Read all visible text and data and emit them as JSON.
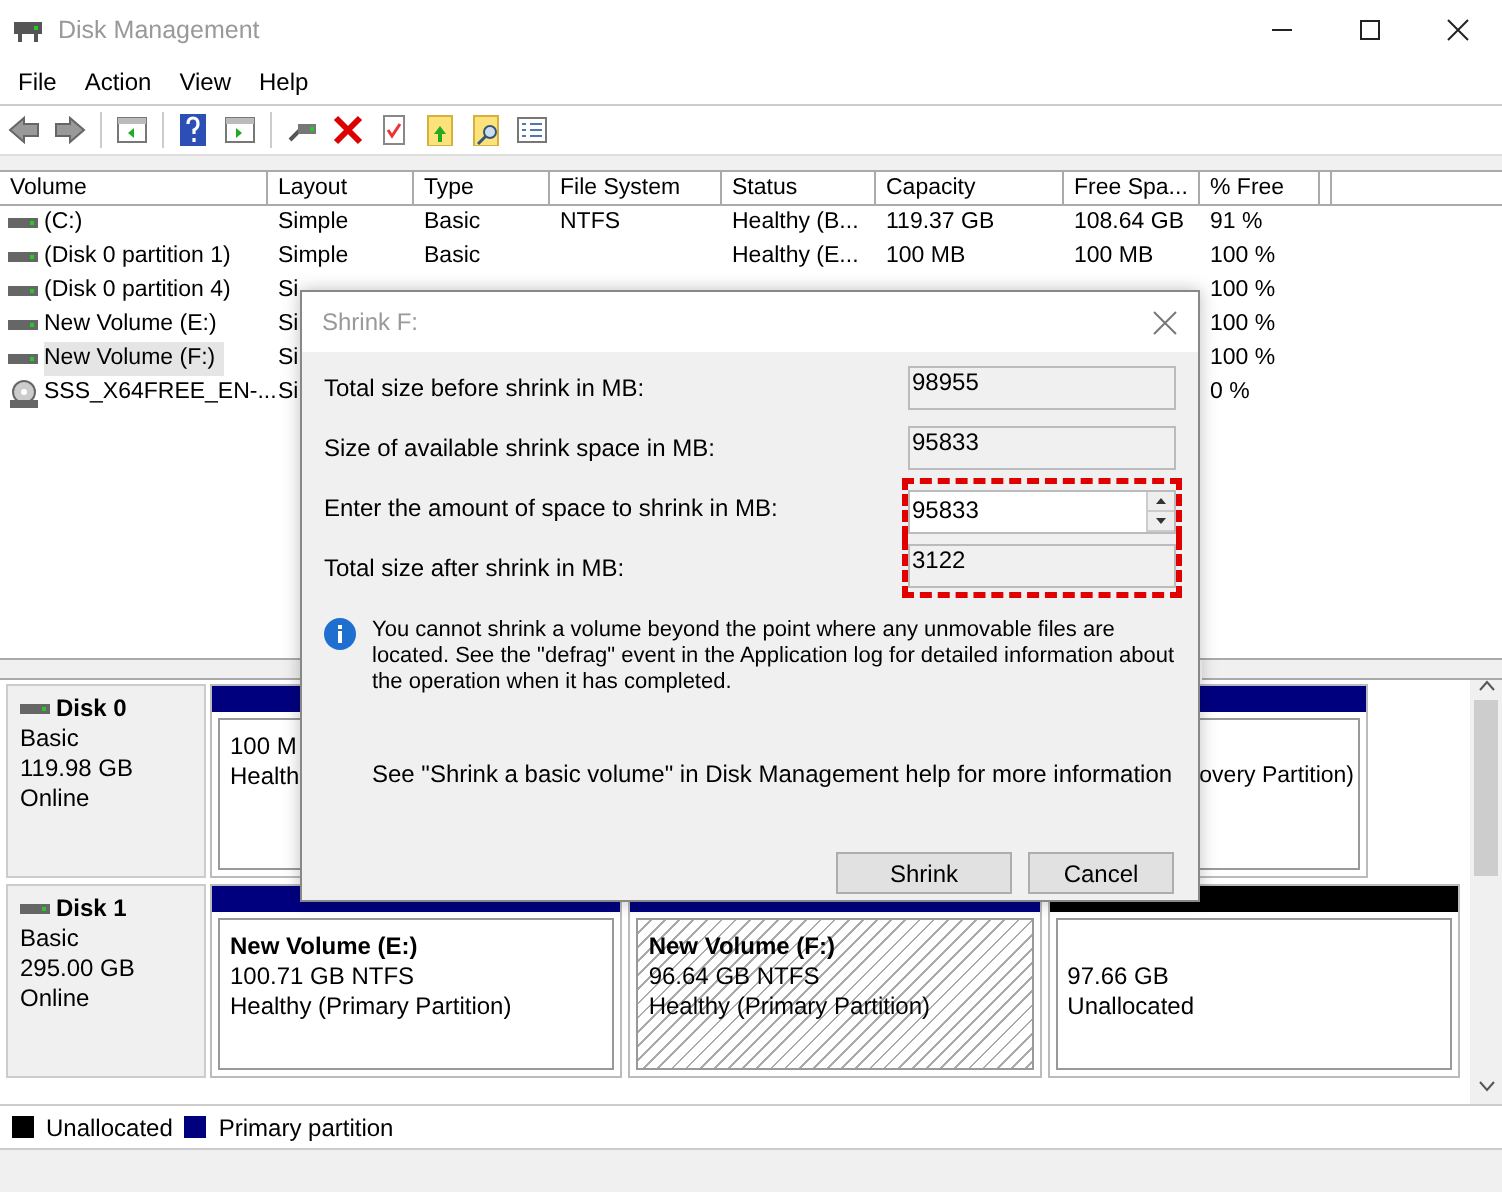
{
  "window": {
    "title": "Disk Management"
  },
  "menu": [
    "File",
    "Action",
    "View",
    "Help"
  ],
  "table": {
    "columns": [
      "Volume",
      "Layout",
      "Type",
      "File System",
      "Status",
      "Capacity",
      "Free Spa...",
      "% Free"
    ],
    "rows": [
      {
        "kind": "disk",
        "selected": false,
        "cells": [
          "(C:)",
          "Simple",
          "Basic",
          "NTFS",
          "Healthy (B...",
          "119.37 GB",
          "108.64 GB",
          "91 %"
        ]
      },
      {
        "kind": "disk",
        "selected": false,
        "cells": [
          "(Disk 0 partition 1)",
          "Simple",
          "Basic",
          "",
          "Healthy (E...",
          "100 MB",
          "100 MB",
          "100 %"
        ]
      },
      {
        "kind": "disk",
        "selected": false,
        "cells": [
          "(Disk 0 partition 4)",
          "Si",
          "",
          "",
          "",
          "",
          "",
          "100 %"
        ]
      },
      {
        "kind": "disk",
        "selected": false,
        "cells": [
          "New Volume (E:)",
          "Si",
          "",
          "",
          "",
          "",
          "",
          "100 %"
        ]
      },
      {
        "kind": "disk",
        "selected": true,
        "cells": [
          "New Volume (F:)",
          "Si",
          "",
          "",
          "",
          "",
          "",
          "100 %"
        ]
      },
      {
        "kind": "cd",
        "selected": false,
        "cells": [
          "SSS_X64FREE_EN-...",
          "Si",
          "",
          "",
          "",
          "",
          "",
          "0 %"
        ]
      }
    ]
  },
  "disks": [
    {
      "name": "Disk 0",
      "type": "Basic",
      "size": "119.98 GB",
      "status": "Online",
      "partitions": [
        {
          "kind": "primary",
          "selected": false,
          "lines": [
            "100 M",
            "Health"
          ]
        },
        {
          "kind": "primary",
          "selected": false,
          "lines": [
            "overy Partition)"
          ]
        }
      ]
    },
    {
      "name": "Disk 1",
      "type": "Basic",
      "size": "295.00 GB",
      "status": "Online",
      "partitions": [
        {
          "kind": "primary",
          "selected": false,
          "title": "New Volume  (E:)",
          "lines": [
            "100.71 GB NTFS",
            "Healthy (Primary Partition)"
          ]
        },
        {
          "kind": "primary",
          "selected": true,
          "title": "New Volume  (F:)",
          "lines": [
            "96.64 GB NTFS",
            "Healthy (Primary Partition)"
          ]
        },
        {
          "kind": "unallocated",
          "selected": false,
          "lines": [
            "97.66 GB",
            "Unallocated"
          ]
        }
      ]
    }
  ],
  "legend": [
    {
      "label": "Unallocated",
      "color": "#000000"
    },
    {
      "label": "Primary partition",
      "color": "#00007f"
    }
  ],
  "dialog": {
    "title": "Shrink F:",
    "fields": [
      {
        "kind": "readonly",
        "label": "Total size before shrink in MB:",
        "value": "98955",
        "highlighted": false
      },
      {
        "kind": "readonly",
        "label": "Size of available shrink space in MB:",
        "value": "95833",
        "highlighted": false
      },
      {
        "kind": "spin",
        "label": "Enter the amount of space to shrink in MB:",
        "value": "95833",
        "highlighted": true
      },
      {
        "kind": "readonly",
        "label": "Total size after shrink in MB:",
        "value": "3122",
        "highlighted": true
      }
    ],
    "note": "You cannot shrink a volume beyond the point where any unmovable files are located. See the \"defrag\" event in the Application log for detailed information about the operation when it has completed.",
    "help": "See \"Shrink a basic volume\" in Disk Management help for more information",
    "buttons": [
      "Shrink",
      "Cancel"
    ]
  }
}
